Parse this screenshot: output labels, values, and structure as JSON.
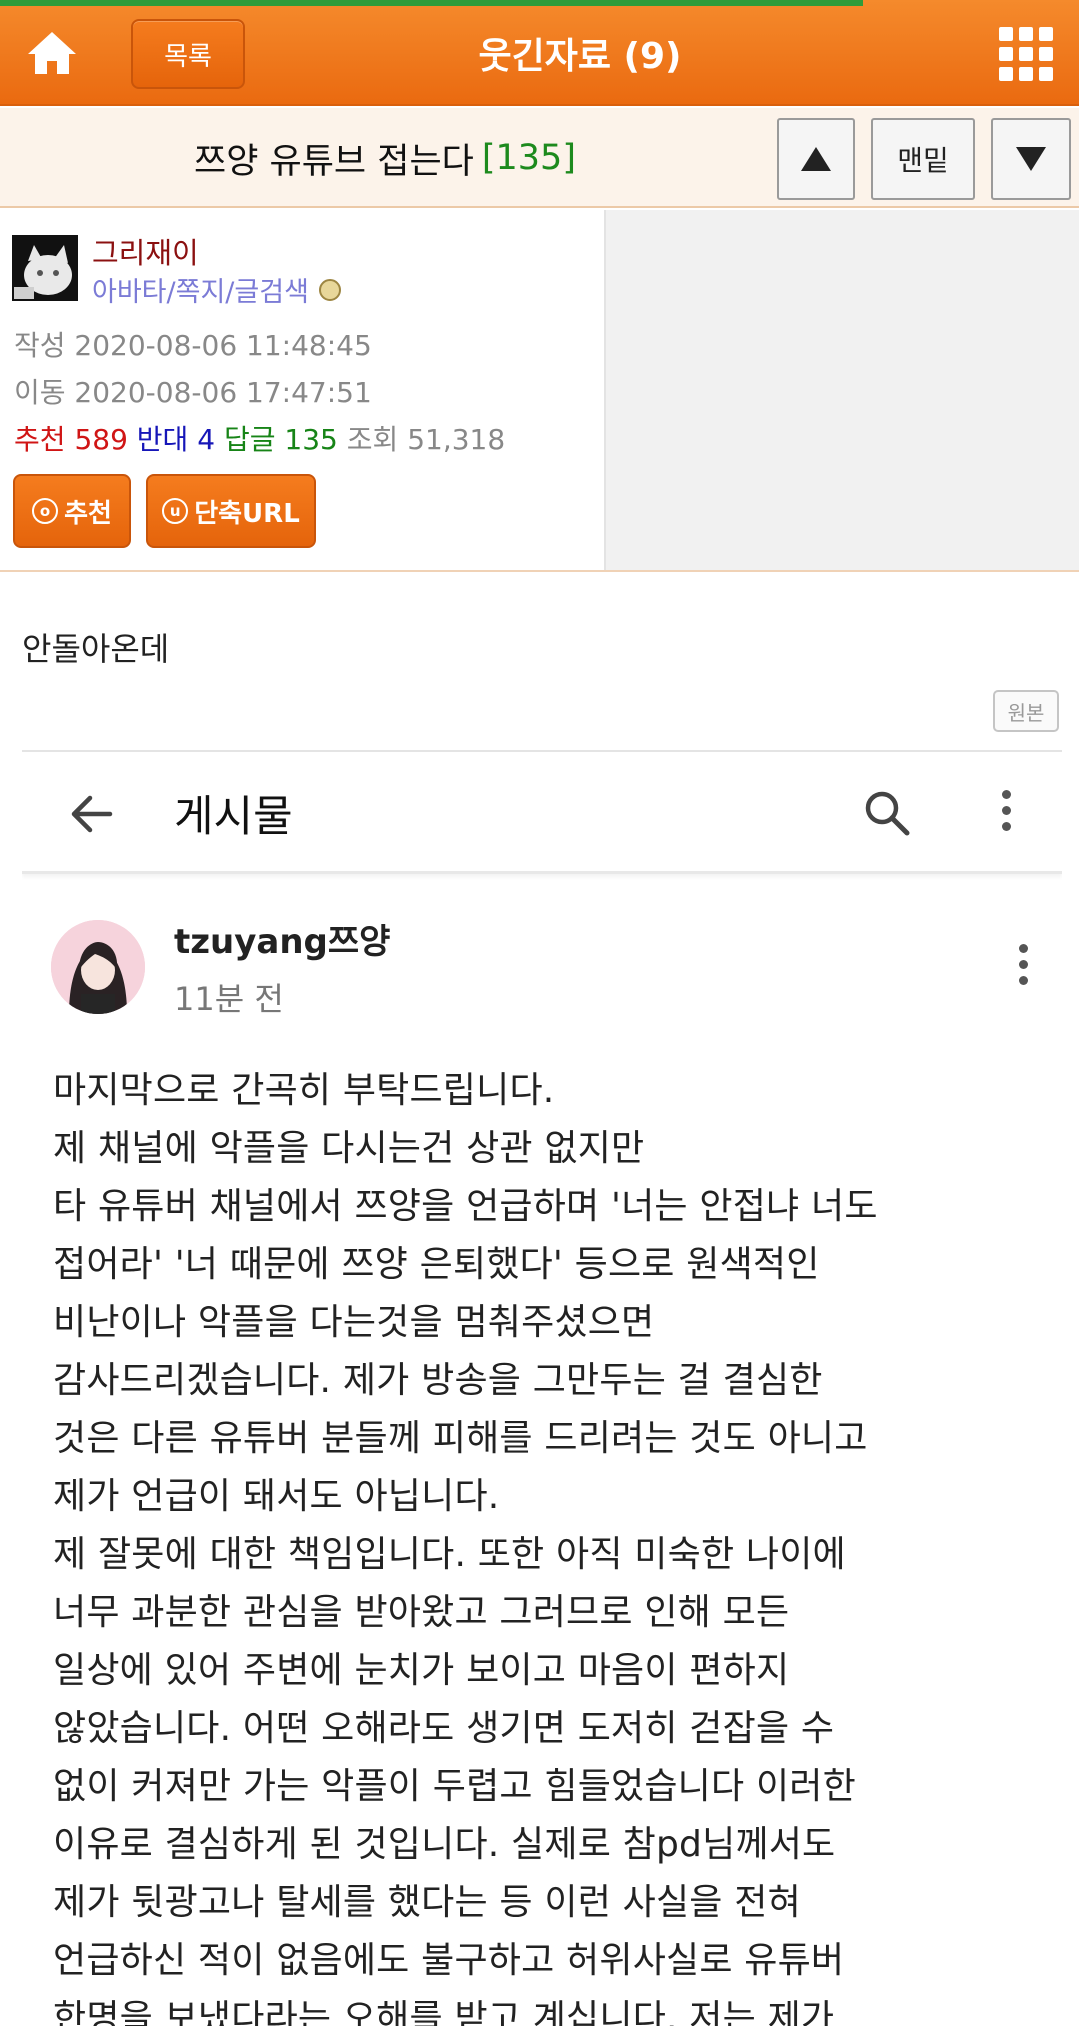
{
  "header": {
    "home_icon": "home-icon",
    "list_label": "목록",
    "board_title": "웃긴자료 (9)",
    "menu_icon": "grid-menu-icon",
    "accent": "#ef7419",
    "progress_color": "#2e9c3a",
    "read_progress": 0.8
  },
  "post": {
    "title": "쯔양 유튜브 접는다",
    "reply_count": "[135]",
    "nav": {
      "up_icon": "arrow-up-icon",
      "bottom_label": "맨밑",
      "down_icon": "arrow-down-icon"
    }
  },
  "author": {
    "nickname": "그리재이",
    "links": "아바타/쪽지/글검색",
    "written": "작성 2020-08-06 11:48:45",
    "moved": "이동 2020-08-06 17:47:51",
    "stats": {
      "recommend_label": "추천",
      "recommend": "589",
      "oppose_label": "반대",
      "oppose": "4",
      "reply_label": "답글",
      "reply": "135",
      "views_label": "조회",
      "views": "51,318"
    },
    "recommend_button": "추천",
    "short_url_button": "단축URL"
  },
  "content": {
    "text": "안돌아온데",
    "original_button": "원본",
    "screenshot": {
      "bar_title": "게시물",
      "channel_name": "tzuyang쯔양",
      "time": "11분 전",
      "lines": [
        "마지막으로 간곡히 부탁드립니다.",
        "제 채널에 악플을 다시는건 상관 없지만",
        "타 유튜버 채널에서 쯔양을 언급하며 '너는 안접냐 너도",
        "접어라' '너 때문에 쯔양 은퇴했다' 등으로 원색적인",
        "비난이나 악플을 다는것을 멈춰주셨으면",
        "감사드리겠습니다. 제가 방송을 그만두는 걸 결심한",
        "것은 다른 유튜버 분들께 피해를 드리려는 것도 아니고",
        "제가 언급이 돼서도 아닙니다.",
        "제 잘못에 대한 책임입니다. 또한 아직 미숙한 나이에",
        "너무 과분한 관심을 받아왔고 그러므로 인해 모든",
        "일상에 있어 주변에 눈치가 보이고 마음이 편하지",
        "않았습니다. 어떤 오해라도 생기면 도저히 걷잡을 수",
        "없이 커져만 가는 악플이 두렵고 힘들었습니다 이러한",
        "이유로 결심하게 된 것입니다. 실제로 참pd님께서도",
        "제가 뒷광고나 탈세를 했다는 등 이런 사실을 전혀",
        "언급하신 적이 없음에도 불구하고 허위사실로 유튜버",
        "한명을 보냈다라는 오해를 받고 계십니다. 저는 제가"
      ]
    }
  }
}
